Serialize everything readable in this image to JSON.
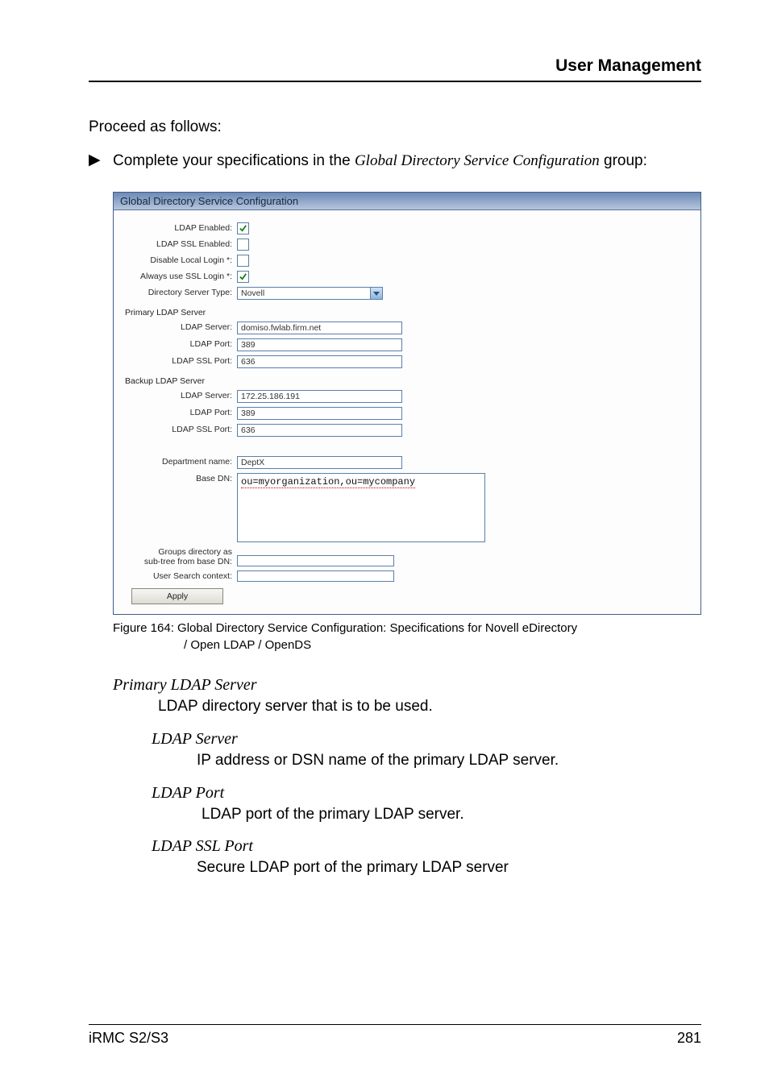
{
  "header": {
    "title": "User Management"
  },
  "intro": {
    "lead": "Proceed as follows:",
    "bullet": "▶",
    "step_pre": "Complete your specifications in the ",
    "step_em": "Global Directory Service Configuration",
    "step_post": " group:"
  },
  "figure": {
    "titlebar": "Global Directory Service Configuration",
    "rows": {
      "ldap_enabled": {
        "label": "LDAP Enabled:",
        "checked": true
      },
      "ldap_ssl_enabled": {
        "label": "LDAP SSL Enabled:",
        "checked": false
      },
      "disable_local": {
        "label": "Disable Local Login *:",
        "checked": false
      },
      "always_ssl": {
        "label": "Always use SSL Login *:",
        "checked": true
      },
      "dir_type": {
        "label": "Directory Server Type:",
        "value": "Novell"
      }
    },
    "sections": {
      "primary": {
        "heading": "Primary LDAP Server",
        "server": {
          "label": "LDAP Server:",
          "value": "domiso.fwlab.firm.net"
        },
        "port": {
          "label": "LDAP Port:",
          "value": "389"
        },
        "ssl_port": {
          "label": "LDAP SSL Port:",
          "value": "636"
        }
      },
      "backup": {
        "heading": "Backup LDAP Server",
        "server": {
          "label": "LDAP Server:",
          "value": "172.25.186.191"
        },
        "port": {
          "label": "LDAP Port:",
          "value": "389"
        },
        "ssl_port": {
          "label": "LDAP SSL Port:",
          "value": "636"
        }
      },
      "dept": {
        "label": "Department name:",
        "value": "DeptX"
      },
      "base_dn": {
        "label": "Base DN:",
        "value": "ou=myorganization,ou=mycompany"
      },
      "groups_dir": {
        "label": "Groups directory as\nsub-tree from base DN:"
      },
      "user_search": {
        "label": "User Search context:"
      }
    },
    "apply": "Apply"
  },
  "caption": {
    "line1": "Figure 164: Global Directory Service Configuration: Specifications for Novell eDirectory",
    "line2": "/ Open LDAP / OpenDS"
  },
  "defs": {
    "primary_term": "Primary LDAP Server",
    "primary_body": "LDAP directory server that is to be used.",
    "server_term": "LDAP Server",
    "server_body": "IP address or DSN name of the primary LDAP server.",
    "port_term": "LDAP Port",
    "port_body": "LDAP port of the primary LDAP server.",
    "ssl_term": "LDAP SSL Port",
    "ssl_body": "Secure LDAP port of the primary LDAP server"
  },
  "footer": {
    "left": "iRMC S2/S3",
    "right": "281"
  }
}
